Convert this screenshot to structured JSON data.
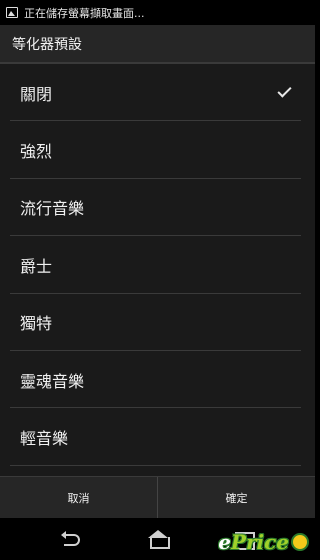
{
  "status_bar": {
    "text": "正在儲存螢幕擷取畫面..."
  },
  "dialog": {
    "title": "等化器預設",
    "items": [
      {
        "label": "關閉",
        "selected": true
      },
      {
        "label": "強烈",
        "selected": false
      },
      {
        "label": "流行音樂",
        "selected": false
      },
      {
        "label": "爵士",
        "selected": false
      },
      {
        "label": "獨特",
        "selected": false
      },
      {
        "label": "靈魂音樂",
        "selected": false
      },
      {
        "label": "輕音樂",
        "selected": false
      }
    ],
    "cancel_label": "取消",
    "confirm_label": "確定"
  },
  "watermark": {
    "prefix": "e",
    "accent": "Price"
  },
  "colors": {
    "list_bg": "#1a1a1a",
    "title_bg": "#262626",
    "divider": "#3a3a3a",
    "watermark_accent": "#9fd02a"
  }
}
